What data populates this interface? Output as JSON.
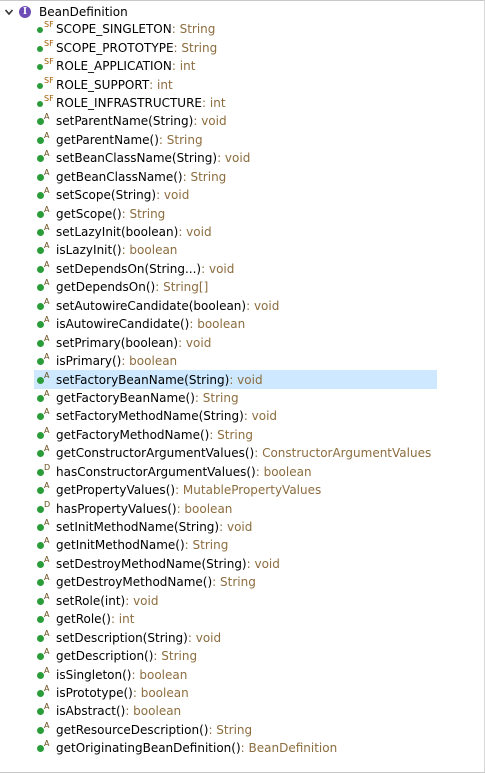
{
  "tree": {
    "root_label": "BeanDefinition",
    "root_icon_letter": "I",
    "members": [
      {
        "name": "SCOPE_SINGLETON",
        "type": " : String",
        "overlay": "SF",
        "kind": "field"
      },
      {
        "name": "SCOPE_PROTOTYPE",
        "type": " : String",
        "overlay": "SF",
        "kind": "field"
      },
      {
        "name": "ROLE_APPLICATION",
        "type": " : int",
        "overlay": "SF",
        "kind": "field"
      },
      {
        "name": "ROLE_SUPPORT",
        "type": " : int",
        "overlay": "SF",
        "kind": "field"
      },
      {
        "name": "ROLE_INFRASTRUCTURE",
        "type": " : int",
        "overlay": "SF",
        "kind": "field"
      },
      {
        "name": "setParentName(String)",
        "type": " : void",
        "overlay": "A",
        "kind": "method"
      },
      {
        "name": "getParentName()",
        "type": " : String",
        "overlay": "A",
        "kind": "method"
      },
      {
        "name": "setBeanClassName(String)",
        "type": " : void",
        "overlay": "A",
        "kind": "method"
      },
      {
        "name": "getBeanClassName()",
        "type": " : String",
        "overlay": "A",
        "kind": "method"
      },
      {
        "name": "setScope(String)",
        "type": " : void",
        "overlay": "A",
        "kind": "method"
      },
      {
        "name": "getScope()",
        "type": " : String",
        "overlay": "A",
        "kind": "method"
      },
      {
        "name": "setLazyInit(boolean)",
        "type": " : void",
        "overlay": "A",
        "kind": "method"
      },
      {
        "name": "isLazyInit()",
        "type": " : boolean",
        "overlay": "A",
        "kind": "method"
      },
      {
        "name": "setDependsOn(String...)",
        "type": " : void",
        "overlay": "A",
        "kind": "method"
      },
      {
        "name": "getDependsOn()",
        "type": " : String[]",
        "overlay": "A",
        "kind": "method"
      },
      {
        "name": "setAutowireCandidate(boolean)",
        "type": " : void",
        "overlay": "A",
        "kind": "method"
      },
      {
        "name": "isAutowireCandidate()",
        "type": " : boolean",
        "overlay": "A",
        "kind": "method"
      },
      {
        "name": "setPrimary(boolean)",
        "type": " : void",
        "overlay": "A",
        "kind": "method"
      },
      {
        "name": "isPrimary()",
        "type": " : boolean",
        "overlay": "A",
        "kind": "method"
      },
      {
        "name": "setFactoryBeanName(String)",
        "type": " : void",
        "overlay": "A",
        "kind": "method",
        "selected": true
      },
      {
        "name": "getFactoryBeanName()",
        "type": " : String",
        "overlay": "A",
        "kind": "method"
      },
      {
        "name": "setFactoryMethodName(String)",
        "type": " : void",
        "overlay": "A",
        "kind": "method"
      },
      {
        "name": "getFactoryMethodName()",
        "type": " : String",
        "overlay": "A",
        "kind": "method"
      },
      {
        "name": "getConstructorArgumentValues()",
        "type": " : ConstructorArgumentValues",
        "overlay": "A",
        "kind": "method"
      },
      {
        "name": "hasConstructorArgumentValues()",
        "type": " : boolean",
        "overlay": "D",
        "kind": "method"
      },
      {
        "name": "getPropertyValues()",
        "type": " : MutablePropertyValues",
        "overlay": "A",
        "kind": "method"
      },
      {
        "name": "hasPropertyValues()",
        "type": " : boolean",
        "overlay": "D",
        "kind": "method"
      },
      {
        "name": "setInitMethodName(String)",
        "type": " : void",
        "overlay": "A",
        "kind": "method"
      },
      {
        "name": "getInitMethodName()",
        "type": " : String",
        "overlay": "A",
        "kind": "method"
      },
      {
        "name": "setDestroyMethodName(String)",
        "type": " : void",
        "overlay": "A",
        "kind": "method"
      },
      {
        "name": "getDestroyMethodName()",
        "type": " : String",
        "overlay": "A",
        "kind": "method"
      },
      {
        "name": "setRole(int)",
        "type": " : void",
        "overlay": "A",
        "kind": "method"
      },
      {
        "name": "getRole()",
        "type": " : int",
        "overlay": "A",
        "kind": "method"
      },
      {
        "name": "setDescription(String)",
        "type": " : void",
        "overlay": "A",
        "kind": "method"
      },
      {
        "name": "getDescription()",
        "type": " : String",
        "overlay": "A",
        "kind": "method"
      },
      {
        "name": "isSingleton()",
        "type": " : boolean",
        "overlay": "A",
        "kind": "method"
      },
      {
        "name": "isPrototype()",
        "type": " : boolean",
        "overlay": "A",
        "kind": "method"
      },
      {
        "name": "isAbstract()",
        "type": " : boolean",
        "overlay": "A",
        "kind": "method"
      },
      {
        "name": "getResourceDescription()",
        "type": " : String",
        "overlay": "A",
        "kind": "method"
      },
      {
        "name": "getOriginatingBeanDefinition()",
        "type": " : BeanDefinition",
        "overlay": "A",
        "kind": "method"
      }
    ]
  },
  "colors": {
    "selection": "#cde8ff",
    "type_text": "#8c6d3f",
    "public_icon": "#2a9d3a",
    "interface_icon": "#6d4db5"
  }
}
